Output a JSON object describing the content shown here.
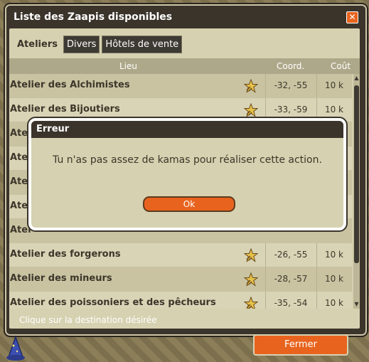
{
  "window": {
    "title": "Liste des Zaapis disponibles",
    "close_glyph": "✕"
  },
  "tabs": [
    {
      "label": "Ateliers",
      "active": true
    },
    {
      "label": "Divers",
      "active": false
    },
    {
      "label": "Hôtels de vente",
      "active": false
    }
  ],
  "columns": {
    "lieu": "Lieu",
    "coord": "Coord.",
    "cout": "Coût"
  },
  "rows": [
    {
      "name": "Atelier des Alchimistes",
      "coord": "-32, -55",
      "cost": "10 k"
    },
    {
      "name": "Atelier des Bijoutiers",
      "coord": "-33, -59",
      "cost": "10 k"
    },
    {
      "name": "Atel",
      "coord": "",
      "cost": ""
    },
    {
      "name": "Atel",
      "coord": "",
      "cost": ""
    },
    {
      "name": "Atel",
      "coord": "",
      "cost": ""
    },
    {
      "name": "Atel",
      "coord": "",
      "cost": ""
    },
    {
      "name": "Atel",
      "coord": "",
      "cost": ""
    },
    {
      "name": "Atelier des forgerons",
      "coord": "-26, -55",
      "cost": "10 k"
    },
    {
      "name": "Atelier des mineurs",
      "coord": "-28, -57",
      "cost": "10 k"
    },
    {
      "name": "Atelier des poissoniers et des pêcheurs",
      "coord": "-35, -54",
      "cost": "10 k"
    }
  ],
  "footer": {
    "hint": "Clique sur la destination désirée",
    "close_button": "Fermer"
  },
  "dialog": {
    "title": "Erreur",
    "message": "Tu n'as pas assez de kamas pour réaliser cette action.",
    "ok": "Ok"
  },
  "colors": {
    "accent": "#e8641e",
    "frame": "#3a342b",
    "panel": "#d6d1b0"
  },
  "icons": {
    "row_icon": "zaap-star-icon",
    "close": "close-icon"
  }
}
